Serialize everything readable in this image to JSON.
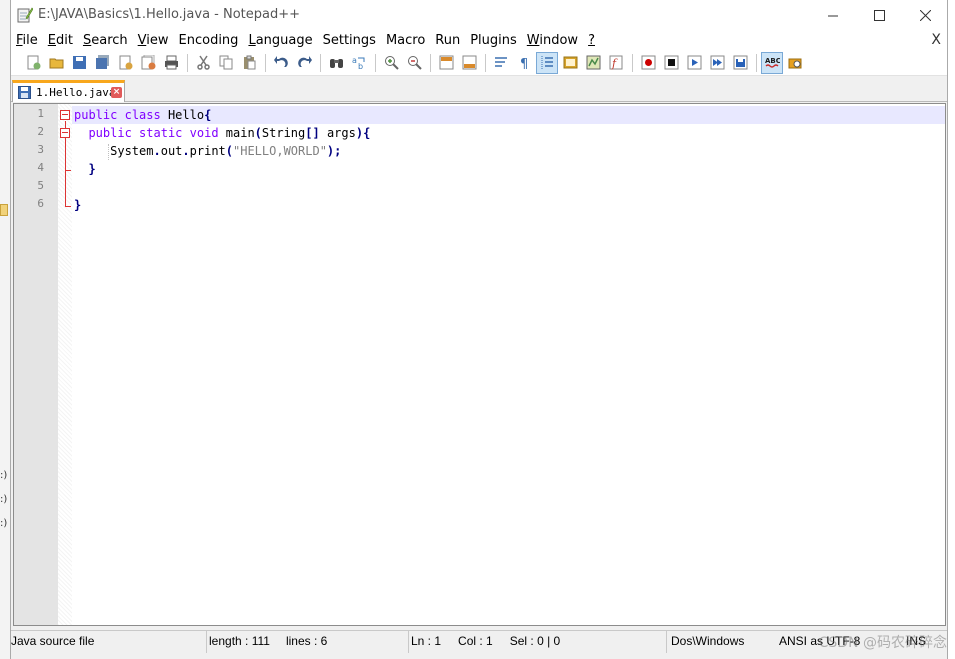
{
  "window": {
    "title": "E:\\JAVA\\Basics\\1.Hello.java - Notepad++",
    "controls": {
      "minimize": "—",
      "maximize": "☐",
      "close": "✕"
    }
  },
  "menu": {
    "items": [
      {
        "accel": "F",
        "rest": "ile"
      },
      {
        "accel": "E",
        "rest": "dit"
      },
      {
        "accel": "S",
        "rest": "earch"
      },
      {
        "accel": "V",
        "rest": "iew"
      },
      {
        "accel": "",
        "rest": "Encoding"
      },
      {
        "accel": "L",
        "rest": "anguage"
      },
      {
        "accel": "",
        "rest": "Settings"
      },
      {
        "accel": "",
        "rest": "Macro"
      },
      {
        "accel": "",
        "rest": "Run"
      },
      {
        "accel": "",
        "rest": "Plugins"
      },
      {
        "accel": "W",
        "rest": "indow"
      },
      {
        "accel": "?",
        "rest": ""
      }
    ],
    "close_doc": "X"
  },
  "toolbar": {
    "colors": {
      "new": "#7fb26b",
      "open": "#e8b73c",
      "save": "#3f6fb5",
      "save_all": "#4b74b0",
      "close": "#d9a441",
      "close_all": "#d97c41",
      "print": "#555555",
      "cut": "#777777",
      "copy": "#8a8a8a",
      "paste": "#9a8f6e",
      "undo": "#3c5c8a",
      "redo": "#3c5c8a",
      "find": "#444444",
      "replace": "#3a7ab8",
      "zoom_in": "#4f8f3f",
      "zoom_out": "#c23a3a",
      "sync_v": "#d98a2b",
      "sync_h": "#d98a2b",
      "wrap": "#3a6fb0",
      "all_chars": "#3a6fb0",
      "indent_guide": "#3a6fb0",
      "udl": "#d6a32a",
      "doc_map": "#4a8a4a",
      "func_list": "#c0392b",
      "rec": "#cc0000",
      "stop": "#111111",
      "play": "#2a62b8",
      "play_multi": "#2a62b8",
      "save_macro": "#2a62b8",
      "spell": "#c62828",
      "spell_auto": "#e6a020"
    }
  },
  "tab": {
    "label": "1.Hello.java",
    "accent": "#f8a71c"
  },
  "editor": {
    "line_numbers": [
      "1",
      "2",
      "3",
      "4",
      "5",
      "6"
    ],
    "lines": [
      [
        {
          "t": "public",
          "c": "kw"
        },
        {
          "t": " ",
          "c": "ident"
        },
        {
          "t": "class",
          "c": "kw"
        },
        {
          "t": " Hello",
          "c": "ident"
        },
        {
          "t": "{",
          "c": "op"
        }
      ],
      [
        {
          "t": "  ",
          "c": "ident"
        },
        {
          "t": "public",
          "c": "kw"
        },
        {
          "t": " ",
          "c": "ident"
        },
        {
          "t": "static",
          "c": "kw"
        },
        {
          "t": " ",
          "c": "ident"
        },
        {
          "t": "void",
          "c": "kw"
        },
        {
          "t": " main",
          "c": "ident"
        },
        {
          "t": "(",
          "c": "op"
        },
        {
          "t": "String",
          "c": "ident"
        },
        {
          "t": "[]",
          "c": "op"
        },
        {
          "t": " args",
          "c": "ident"
        },
        {
          "t": "){",
          "c": "op"
        }
      ],
      [
        {
          "t": "     System",
          "c": "ident"
        },
        {
          "t": ".",
          "c": "op"
        },
        {
          "t": "out",
          "c": "ident"
        },
        {
          "t": ".",
          "c": "op"
        },
        {
          "t": "print",
          "c": "ident"
        },
        {
          "t": "(",
          "c": "op"
        },
        {
          "t": "\"HELLO,WORLD\"",
          "c": "str"
        },
        {
          "t": ");",
          "c": "op"
        }
      ],
      [
        {
          "t": "  ",
          "c": "ident"
        },
        {
          "t": "}",
          "c": "op"
        }
      ],
      [],
      [
        {
          "t": "}",
          "c": "op"
        }
      ]
    ],
    "colors": {
      "keyword": "#8000ff",
      "operator": "#000080",
      "string": "#808080",
      "current_line": "#e8e8ff"
    }
  },
  "status": {
    "file_type": "Java source file",
    "length": "length : 111",
    "lines": "lines : 6",
    "ln": "Ln : 1",
    "col": "Col : 1",
    "sel": "Sel : 0 | 0",
    "eol": "Dos\\Windows",
    "encoding": "ANSI as UTF-8",
    "mode": "INS"
  },
  "watermark": "CSDN @码农碎碎念",
  "background_fragments": [
    ":)",
    ":)",
    ":)"
  ]
}
